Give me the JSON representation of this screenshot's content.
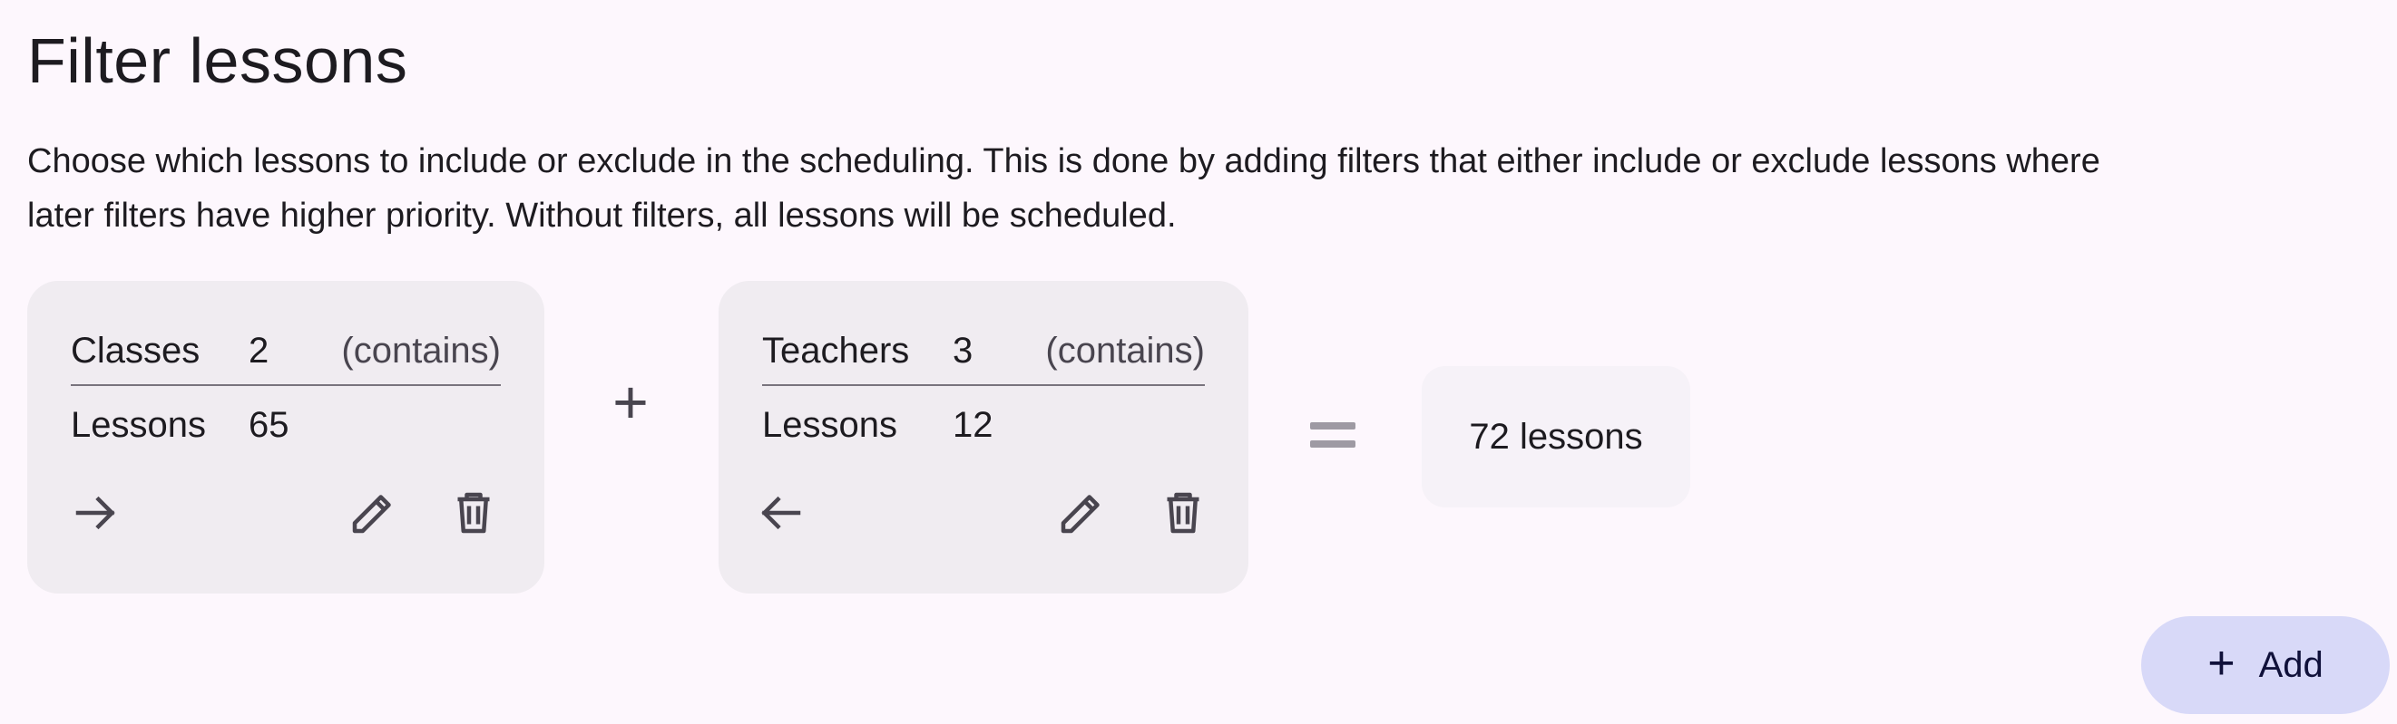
{
  "page": {
    "title": "Filter lessons",
    "description": "Choose which lessons to include or exclude in the scheduling. This is done by adding filters that either include or exclude lessons where later filters have higher priority. Without filters, all lessons will be scheduled."
  },
  "filters": [
    {
      "category": "Classes",
      "count": "2",
      "mode": "(contains)",
      "lessons_label": "Lessons",
      "lessons_count": "65",
      "direction_icon": "arrow-right-icon"
    },
    {
      "category": "Teachers",
      "count": "3",
      "mode": "(contains)",
      "lessons_label": "Lessons",
      "lessons_count": "12",
      "direction_icon": "arrow-left-icon"
    }
  ],
  "operators": {
    "plus": "+",
    "equals": "="
  },
  "result": {
    "label": "72 lessons"
  },
  "add_button": {
    "icon": "+",
    "label": "Add"
  },
  "colors": {
    "background": "#fdf7fd",
    "card": "#f0ecf1",
    "result": "#f6f2f8",
    "fab": "#d8d9f8",
    "icon": "#49454f"
  }
}
